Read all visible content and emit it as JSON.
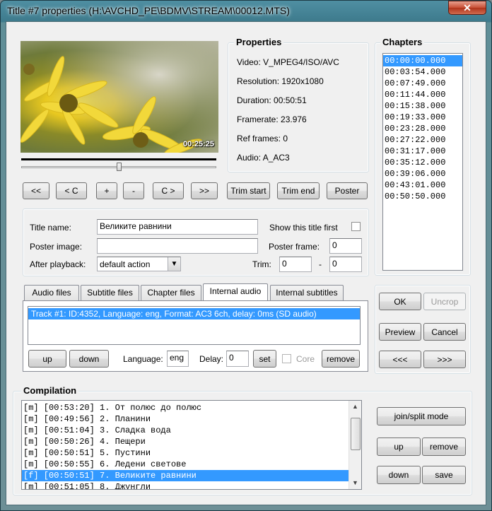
{
  "window": {
    "title": "Title #7 properties (H:\\AVCHD_PE\\BDMV\\STREAM\\00012.MTS)",
    "close_glyph": "✕"
  },
  "preview": {
    "timestamp": "00:25:25",
    "seek_fraction": 0.5
  },
  "player_buttons": [
    "<<",
    "< C",
    "+",
    "-",
    "C >",
    ">>"
  ],
  "trim_buttons": {
    "trim_start": "Trim start",
    "trim_end": "Trim end",
    "poster": "Poster"
  },
  "properties": {
    "title": "Properties",
    "items": [
      "Video: V_MPEG4/ISO/AVC",
      "Resolution: 1920x1080",
      "Duration: 00:50:51",
      "Framerate: 23.976",
      "Ref frames: 0",
      "Audio: A_AC3"
    ]
  },
  "chapters": {
    "title": "Chapters",
    "items": [
      "00:00:00.000",
      "00:03:54.000",
      "00:07:49.000",
      "00:11:44.000",
      "00:15:38.000",
      "00:19:33.000",
      "00:23:28.000",
      "00:27:22.000",
      "00:31:17.000",
      "00:35:12.000",
      "00:39:06.000",
      "00:43:01.000",
      "00:50:50.000"
    ],
    "selected_index": 0
  },
  "title_form": {
    "title_name_label": "Title name:",
    "title_name_value": "Великите равнини",
    "show_first_label": "Show this title first",
    "poster_image_label": "Poster image:",
    "poster_image_value": "",
    "poster_frame_label": "Poster frame:",
    "poster_frame_value": "0",
    "after_playback_label": "After playback:",
    "after_playback_value": "default action",
    "trim_label": "Trim:",
    "trim_start_value": "0",
    "trim_dash": "-",
    "trim_end_value": "0"
  },
  "tabs": [
    "Audio files",
    "Subtitle files",
    "Chapter files",
    "Internal audio",
    "Internal subtitles"
  ],
  "active_tab_index": 3,
  "audio_tracks": {
    "items": [
      "Track #1: ID:4352, Language: eng, Format: AC3 6ch, delay: 0ms (SD audio)"
    ]
  },
  "track_controls": {
    "up": "up",
    "down": "down",
    "language_label": "Language:",
    "language_value": "eng",
    "delay_label": "Delay:",
    "delay_value": "0",
    "set": "set",
    "core_label": "Core",
    "remove": "remove"
  },
  "dialog_buttons": {
    "ok": "OK",
    "uncrop": "Uncrop",
    "preview": "Preview",
    "cancel": "Cancel",
    "prev": "<<<",
    "next": ">>>"
  },
  "compilation": {
    "title": "Compilation",
    "items": [
      "[m] [00:53:20] 1. От полюс до полюс",
      "[m] [00:49:56] 2. Планини",
      "[m] [00:51:04] 3. Сладка вода",
      "[m] [00:50:26] 4. Пещери",
      "[m] [00:50:51] 5. Пустини",
      "[m] [00:50:55] 6. Ледени светове",
      "[f] [00:50:51] 7. Великите равнини",
      "[m] [00:51:05] 8. Джунгли"
    ],
    "selected_index": 6,
    "buttons": {
      "join_split": "join/split mode",
      "up": "up",
      "remove": "remove",
      "down": "down",
      "save": "save"
    }
  }
}
